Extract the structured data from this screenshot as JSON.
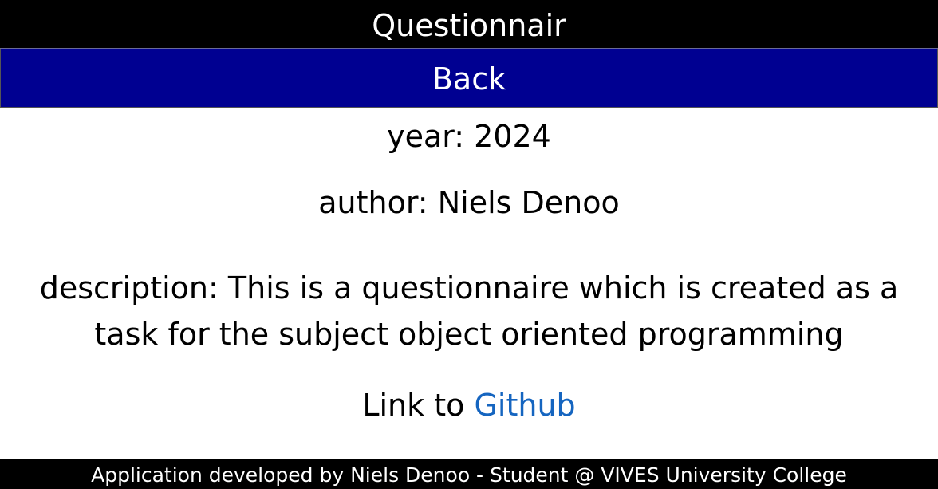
{
  "header": {
    "title": "Questionnair"
  },
  "nav": {
    "back_label": "Back"
  },
  "about": {
    "year_label": "year:",
    "year_value": "2024",
    "author_label": "author:",
    "author_value": "Niels Denoo",
    "description_label": "description:",
    "description_value": "This is a questionnaire which is created as a task for the subject object oriented programming",
    "link_prefix": "Link to",
    "link_text": "Github",
    "link_color": "#1565c0"
  },
  "footer": {
    "text": "Application developed by Niels Denoo - Student @ VIVES University College"
  },
  "colors": {
    "header_bg": "#000000",
    "back_button_bg": "#000091",
    "footer_bg": "#000000"
  }
}
